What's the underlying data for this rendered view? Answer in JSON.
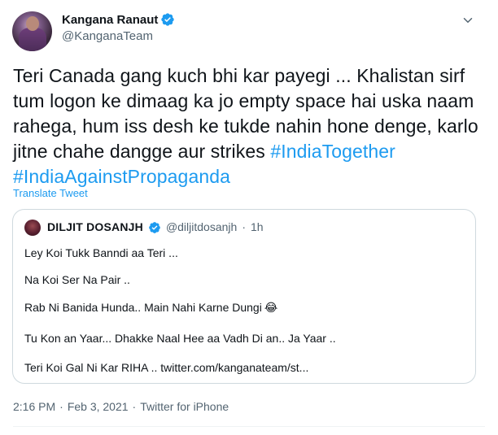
{
  "author": {
    "name": "Kangana Ranaut",
    "handle": "@KanganaTeam",
    "verified": true
  },
  "tweet": {
    "text_lines": [
      "Teri Canada gang kuch bhi kar payegi ... Khalistan sirf",
      "tum logon ke dimaag ka jo empty space hai uska naam",
      "rahega, hum iss desh ke tukde nahin hone denge, karlo",
      "jitne chahe dangge aur strikes "
    ],
    "hashtag_1": "#IndiaTogether",
    "hashtag_2": "#IndiaAgainstPropaganda",
    "translate_label": "Translate Tweet"
  },
  "quoted": {
    "name": "DILJIT DOSANJH",
    "handle": "@diljitdosanjh",
    "separator": "·",
    "time": "1h",
    "lines": [
      "Ley Koi Tukk Banndi aa Teri ...",
      "Na Koi Ser Na Pair ..",
      "Rab Ni Banida Hunda.. Main Nahi Karne Dungi",
      "Tu Kon an Yaar... Dhakke Naal Hee aa Vadh Di an.. Ja Yaar ..",
      "Teri Koi Gal Ni Kar RIHA .. twitter.com/kanganateam/st..."
    ],
    "emoji": "😂"
  },
  "footer": {
    "time": "2:16 PM",
    "separator": "·",
    "date": "Feb 3, 2021",
    "source": "Twitter for iPhone"
  },
  "colors": {
    "accent": "#1d9bf0",
    "text": "#0f1419",
    "secondary": "#536471",
    "border": "#cfd9de"
  },
  "icons": {
    "verified": "verified-badge-icon",
    "more": "chevron-down-icon"
  }
}
